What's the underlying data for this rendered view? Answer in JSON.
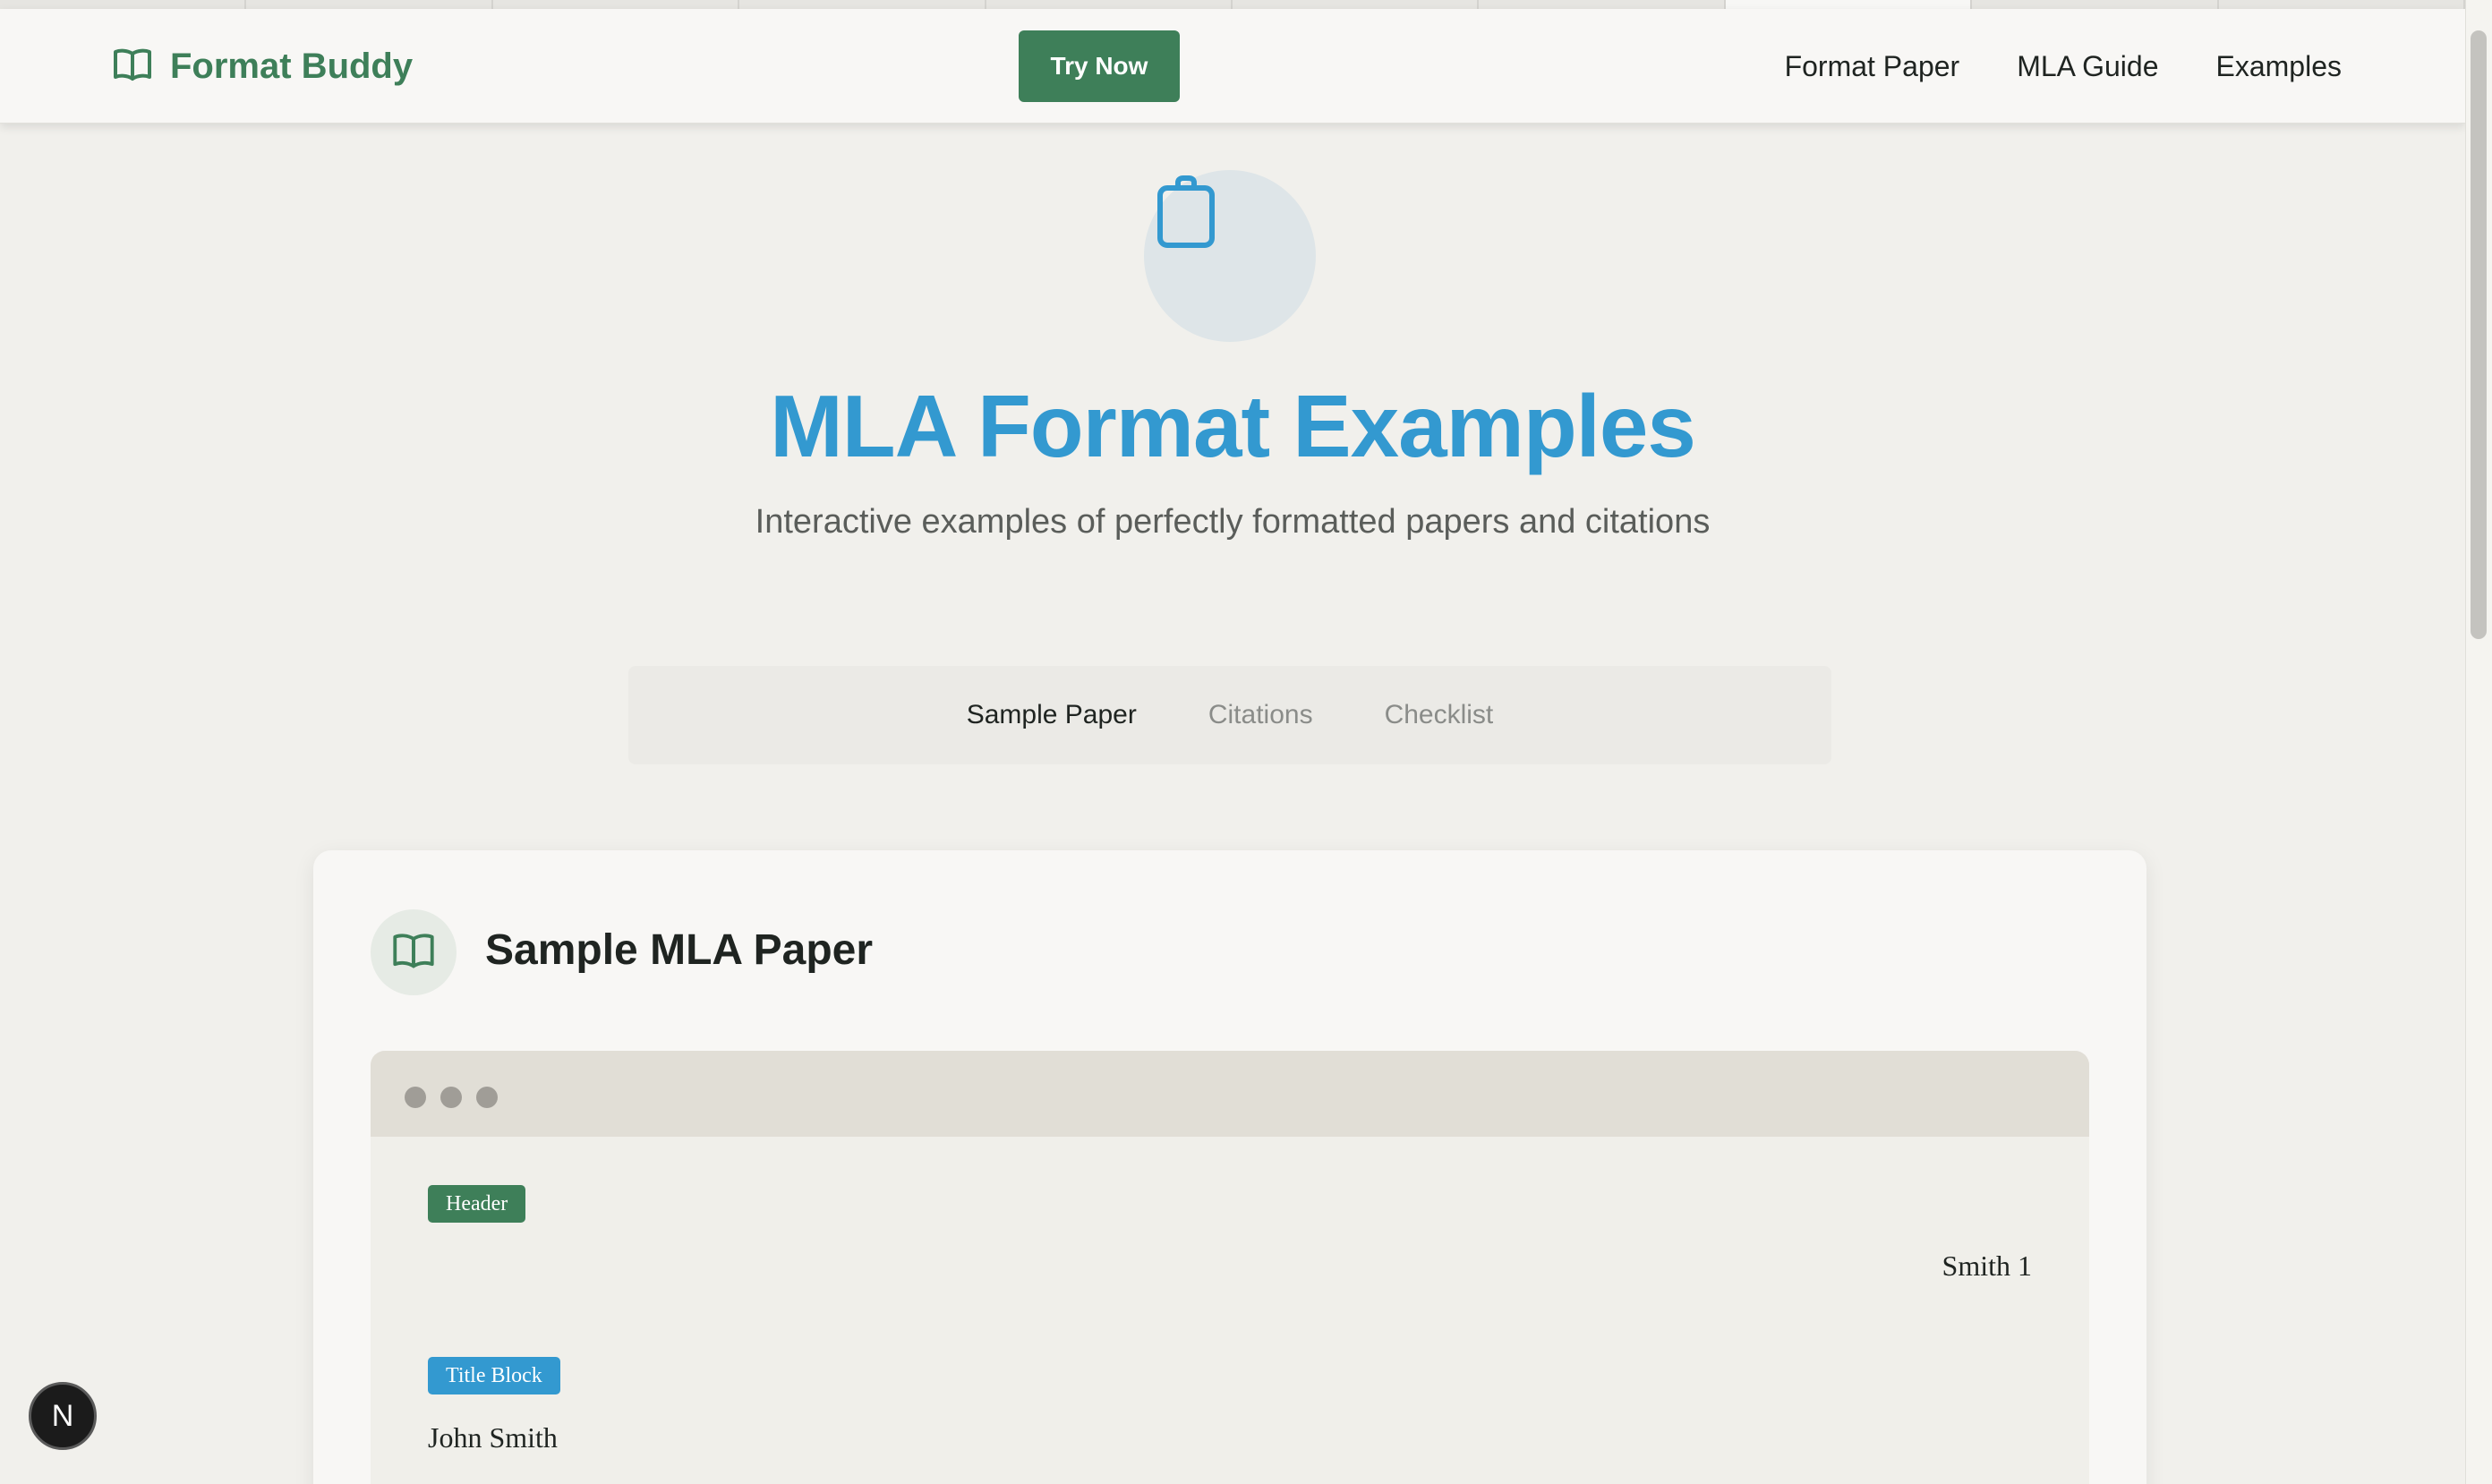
{
  "nav": {
    "logo_icon": "open-book-icon",
    "brand": "Format Buddy",
    "cta": "Try Now",
    "links": [
      "Format Paper",
      "MLA Guide",
      "Examples"
    ]
  },
  "hero": {
    "icon": "clipboard-icon",
    "title": "MLA Format Examples",
    "subtitle": "Interactive examples of perfectly formatted papers and citations"
  },
  "tabs": [
    {
      "label": "Sample Paper",
      "active": true
    },
    {
      "label": "Citations",
      "active": false
    },
    {
      "label": "Checklist",
      "active": false
    }
  ],
  "card": {
    "icon": "open-book-icon",
    "title": "Sample MLA Paper",
    "paper": {
      "header_badge": "Header",
      "running_head": "Smith 1",
      "title_block_badge": "Title Block",
      "author": "John Smith"
    }
  },
  "fab": {
    "label": "N"
  },
  "colors": {
    "brand_green": "#3e7f59",
    "accent_blue": "#3399d0",
    "background": "#f1f0ec"
  }
}
